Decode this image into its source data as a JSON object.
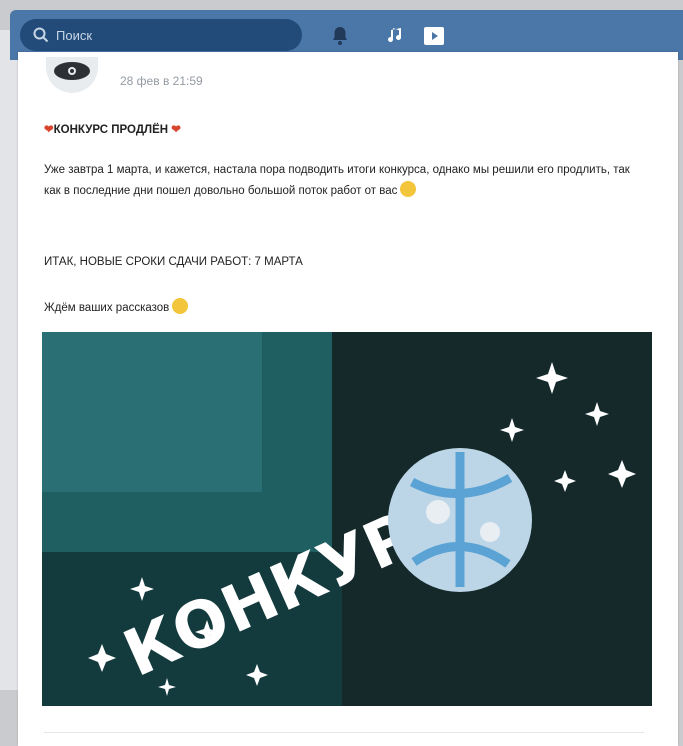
{
  "header": {
    "search_placeholder": "Поиск"
  },
  "post": {
    "author": "",
    "date": "28 фев в 21:59",
    "title": "КОНКУРС ПРОДЛЁН",
    "body": "Уже завтра 1 марта, и кажется, настала пора подводить итоги конкурса, однако мы решили его продлить, так как в последние дни пошел довольно большой поток работ от вас",
    "deadline": "ИТАК, НОВЫЕ СРОКИ СДАЧИ РАБОТ: 7 МАРТА",
    "wait_text": "Ждём ваших рассказов",
    "image_caption": "КОНКУРС"
  },
  "icons": {
    "search": "search-icon",
    "bell": "bell-icon",
    "music": "music-icon",
    "video": "video-icon",
    "heart": "heart-icon",
    "emoji": "smile-emoji-icon"
  },
  "colors": {
    "header_bg": "#4a76a8",
    "search_bg": "#224b7a",
    "photo_bg": "#1e5f61"
  }
}
